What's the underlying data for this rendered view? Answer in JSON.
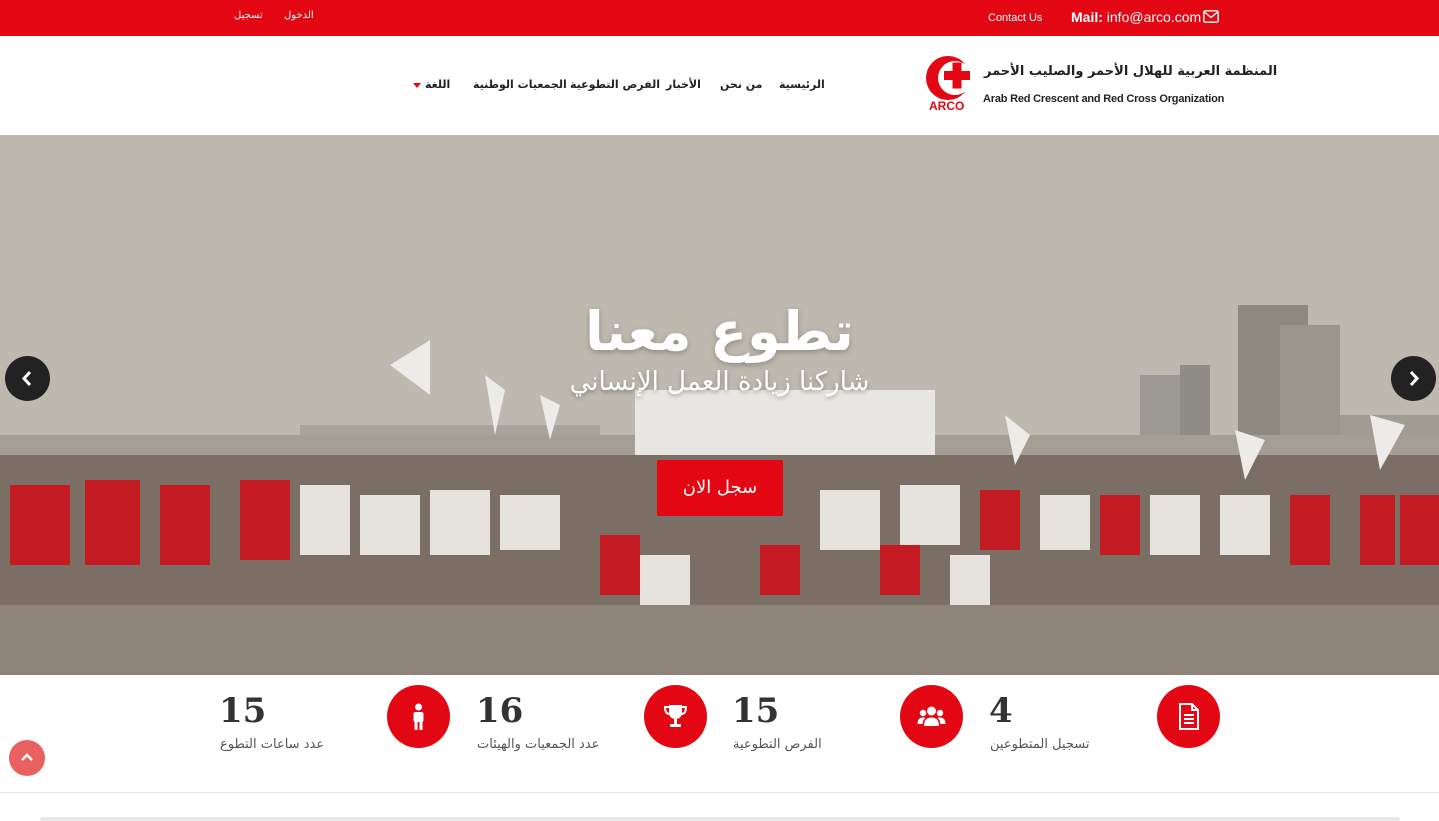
{
  "topbar": {
    "register": "تسجيل",
    "login": "الدخول",
    "contact": "Contact Us",
    "mail_label": "Mail:",
    "mail_value": "info@arco.com"
  },
  "logo": {
    "arabic": "المنظمة العربية للهلال الأحمر والصليب الأحمر",
    "english": "Arab Red Crescent and Red Cross Organization",
    "short": "ARCO"
  },
  "nav": {
    "home": "الرئيسية",
    "about": "من نحن",
    "news": "الأخبار",
    "opportunities": "الفرص التطوعية",
    "societies": "الجمعيات الوطنية",
    "language": "اللغة"
  },
  "hero": {
    "title": "تطوع معنا",
    "subtitle": "شاركنا زيادة العمل الإنساني",
    "cta": "سجل الان"
  },
  "stats": [
    {
      "value": "15",
      "label": "عدد ساعات التطوع",
      "icon": "person-icon"
    },
    {
      "value": "16",
      "label": "عدد الجمعيات والهيئات",
      "icon": "trophy-icon"
    },
    {
      "value": "15",
      "label": "الفرص التطوعية",
      "icon": "users-icon"
    },
    {
      "value": "4",
      "label": "تسجيل المتطوعين",
      "icon": "document-icon"
    }
  ],
  "colors": {
    "brand_red": "#e30613"
  }
}
